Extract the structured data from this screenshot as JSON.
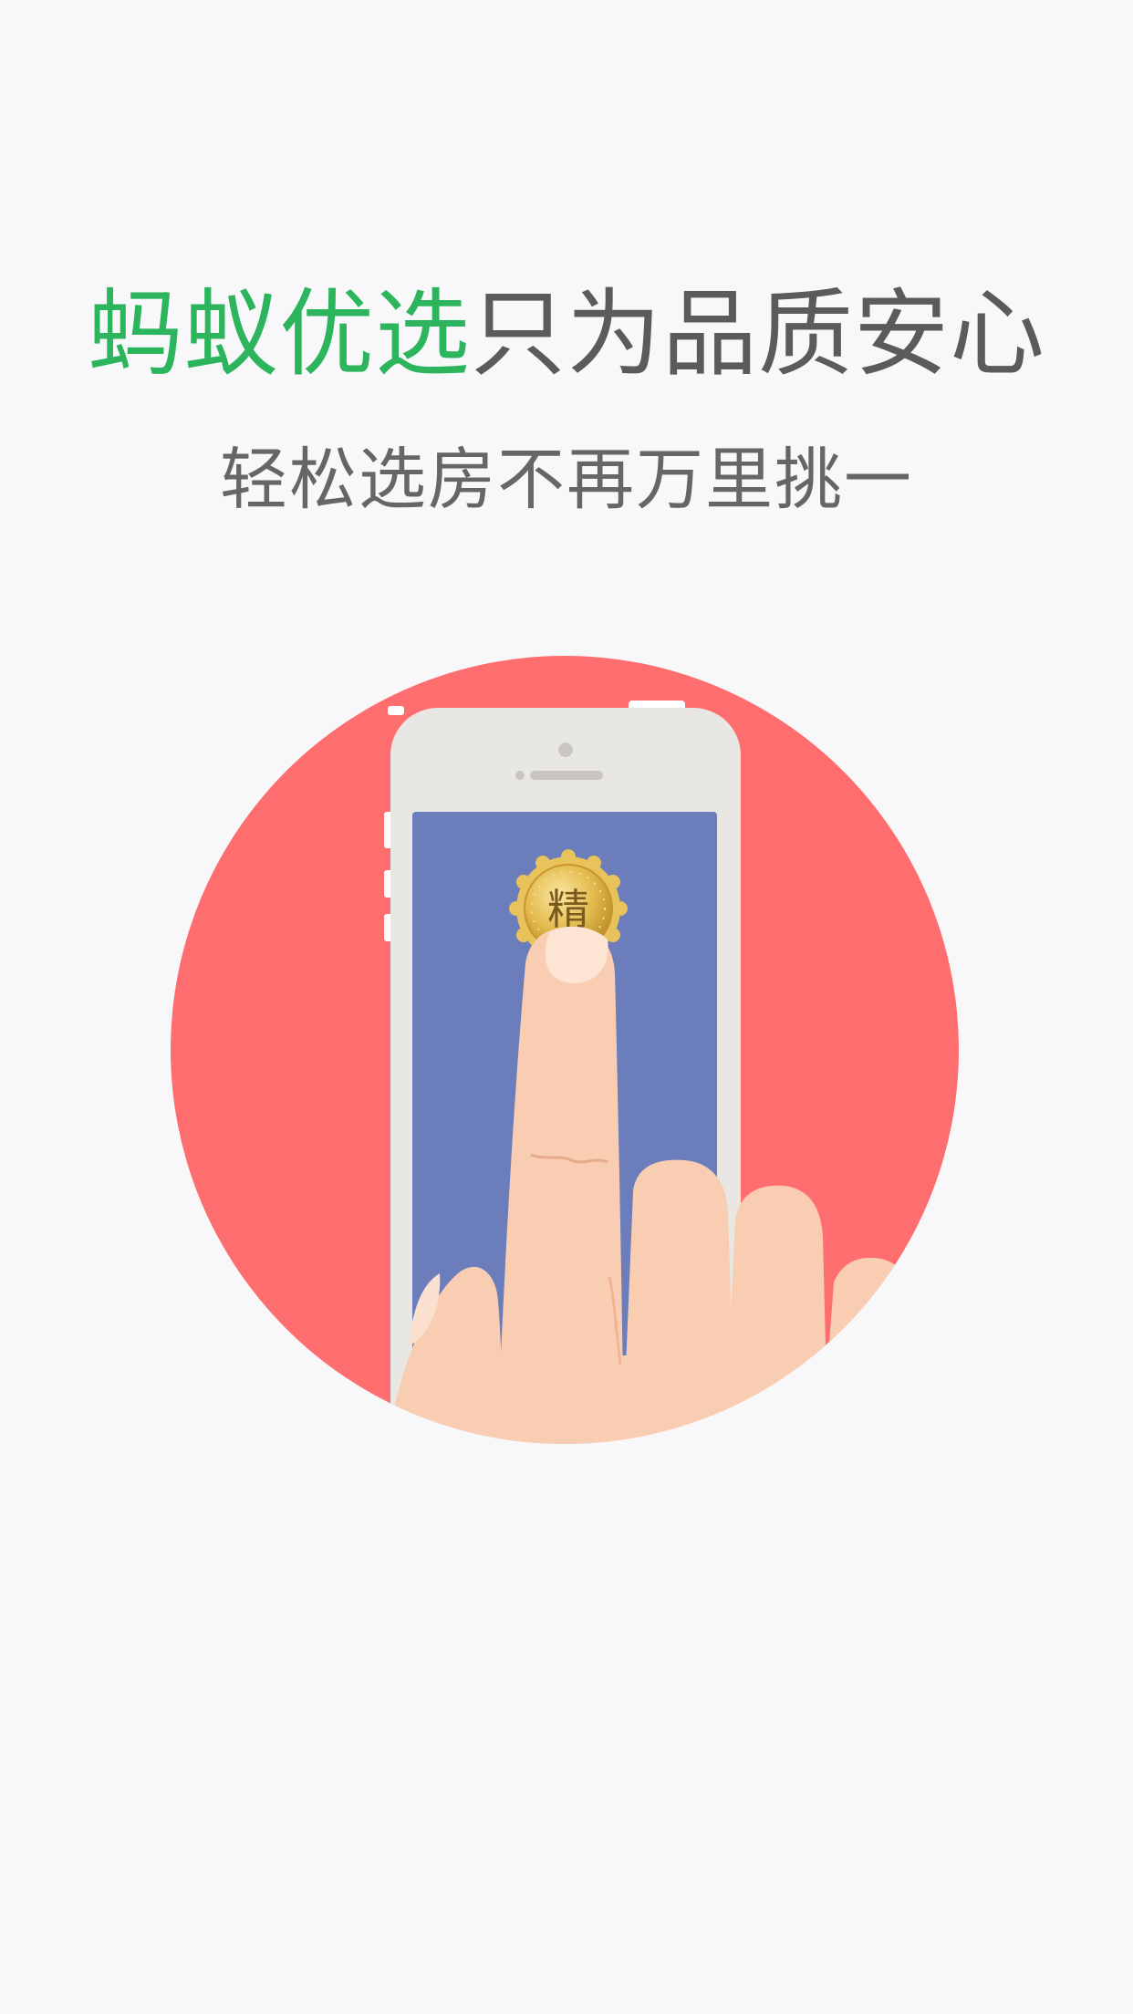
{
  "headline": {
    "accent": "蚂蚁优选",
    "rest": "只为品质安心"
  },
  "subtitle": "轻松选房不再万里挑一",
  "illustration": {
    "badge_char": "精",
    "circle_color": "#ff6e6e",
    "screen_color": "#6b7dba",
    "phone_color": "#e9e7e3",
    "skin_color": "#f9cdb1",
    "badge_color": "#e3bb4f"
  },
  "colors": {
    "accent": "#2cb55c",
    "text": "#5b5b5b",
    "background": "#f8f8fa"
  }
}
